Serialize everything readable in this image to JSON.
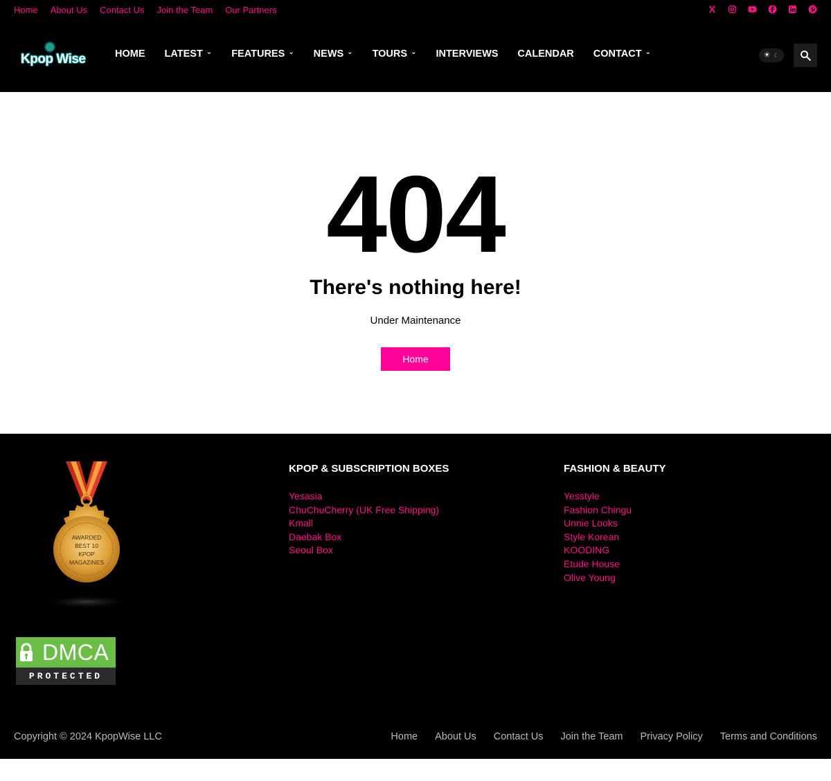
{
  "topnav": {
    "items": [
      "Home",
      "About Us",
      "Contact Us",
      "Join the Team",
      "Our Partners"
    ]
  },
  "social": [
    "x-icon",
    "instagram-icon",
    "youtube-icon",
    "facebook-icon",
    "linkedin-icon",
    "pinterest-icon"
  ],
  "brand": {
    "logo_text": "Kpop Wise"
  },
  "mainnav": {
    "items": [
      {
        "label": "HOME",
        "dropdown": false
      },
      {
        "label": "LATEST",
        "dropdown": true
      },
      {
        "label": "FEATURES",
        "dropdown": true
      },
      {
        "label": "NEWS",
        "dropdown": true
      },
      {
        "label": "TOURS",
        "dropdown": true
      },
      {
        "label": "INTERVIEWS",
        "dropdown": false
      },
      {
        "label": "CALENDAR",
        "dropdown": false
      },
      {
        "label": "CONTACT",
        "dropdown": true
      }
    ]
  },
  "error": {
    "code": "404",
    "headline": "There's nothing here!",
    "message": "Under Maintenance",
    "button": "Home"
  },
  "footer": {
    "badge_text": [
      "AWARDED",
      "BEST 10",
      "KPOP",
      "MAGAZINES"
    ],
    "dmca_word": "DMCA",
    "dmca_sub": "PROTECTED",
    "col1": {
      "title": "KPOP & SUBSCRIPTION BOXES",
      "links": [
        "Yesasia",
        "ChuChuCherry (UK Free Shipping)",
        "Kmall",
        "Daebak Box",
        "Seoul Box"
      ]
    },
    "col2": {
      "title": "FASHION & BEAUTY",
      "links": [
        "Yesstyle",
        "Fashion Chingu",
        "Unnie Looks",
        "Style Korean",
        "KOODING",
        "Etude House",
        "Olive Young"
      ]
    },
    "copyright": "Copyright © 2024 KpopWise LLC",
    "bottomnav": [
      "Home",
      "About Us",
      "Contact Us",
      "Join the Team",
      "Privacy Policy",
      "Terms and Conditions"
    ]
  },
  "colors": {
    "accent": "#ff0399",
    "link": "#ff0f8a",
    "background_dark": "#000000"
  }
}
